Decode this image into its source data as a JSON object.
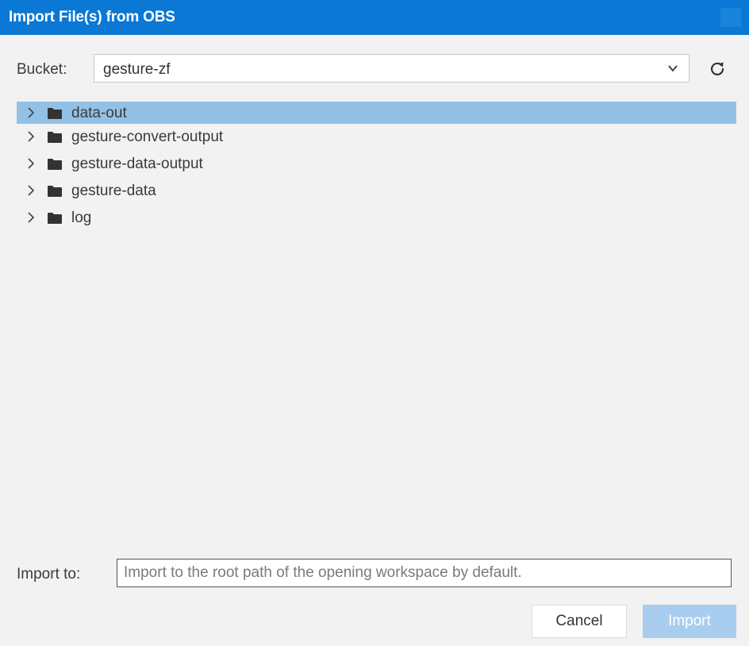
{
  "dialog": {
    "title": "Import File(s) from OBS"
  },
  "bucket": {
    "label": "Bucket:",
    "value": "gesture-zf",
    "dropdown_icon": "chevron-down-icon",
    "refresh_icon": "refresh-icon"
  },
  "tree": {
    "items": [
      {
        "label": "data-out",
        "selected": true
      },
      {
        "label": "gesture-convert-output",
        "selected": false
      },
      {
        "label": "gesture-data-output",
        "selected": false
      },
      {
        "label": "gesture-data",
        "selected": false
      },
      {
        "label": "log",
        "selected": false
      }
    ]
  },
  "import_to": {
    "label": "Import to:",
    "placeholder": "Import to the root path of the opening workspace by default."
  },
  "buttons": {
    "cancel_label": "Cancel",
    "import_label": "Import"
  },
  "colors": {
    "titlebar": "#0a78d4",
    "selected_row": "#93c1e6",
    "import_button_disabled": "#a9cdee"
  }
}
